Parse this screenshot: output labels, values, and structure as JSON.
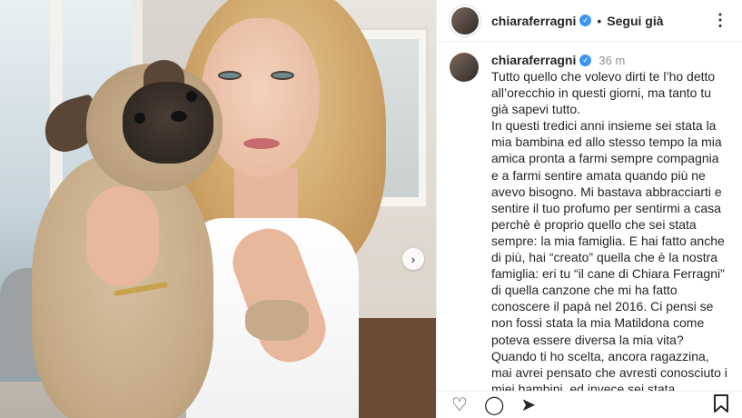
{
  "header": {
    "username": "chiaraferragni",
    "verified_icon": "verified-badge-icon",
    "separator": "•",
    "follow_label": "Segui già",
    "more_icon": "⋮"
  },
  "caption": {
    "username": "chiaraferragni",
    "time": "36 m",
    "text": "Tutto quello che volevo dirti te l’ho detto all’orecchio in questi giorni, ma tanto tu già sapevi tutto.\nIn questi tredici anni insieme sei stata la mia bambina ed allo stesso tempo la mia amica pronta a farmi sempre compagnia e a farmi sentire amata quando più ne avevo bisogno. Mi bastava abbracciarti e sentire il tuo profumo per sentirmi a casa perchè è proprio quello che sei stata sempre: la mia famiglia. E hai fatto anche di più, hai “creato” quella che è la nostra famiglia: eri tu “il cane di Chiara Ferragni” di quella canzone che mi ha fatto conoscere il papà nel 2016. Ci pensi se non fossi stata la mia Matildona come poteva essere diversa la mia vita? Quando ti ho scelta, ancora ragazzina, mai avrei pensato che avresti conosciuto i miei bambini, ed invece sei stata"
  },
  "media": {
    "carousel_next_icon": "›"
  },
  "actions": {
    "like_icon": "♡",
    "comment_icon": "◯",
    "share_icon": "➤",
    "save_icon": "🔖"
  },
  "colors": {
    "verified": "#3897f0",
    "text": "#262626",
    "muted": "#8e8e8e"
  }
}
